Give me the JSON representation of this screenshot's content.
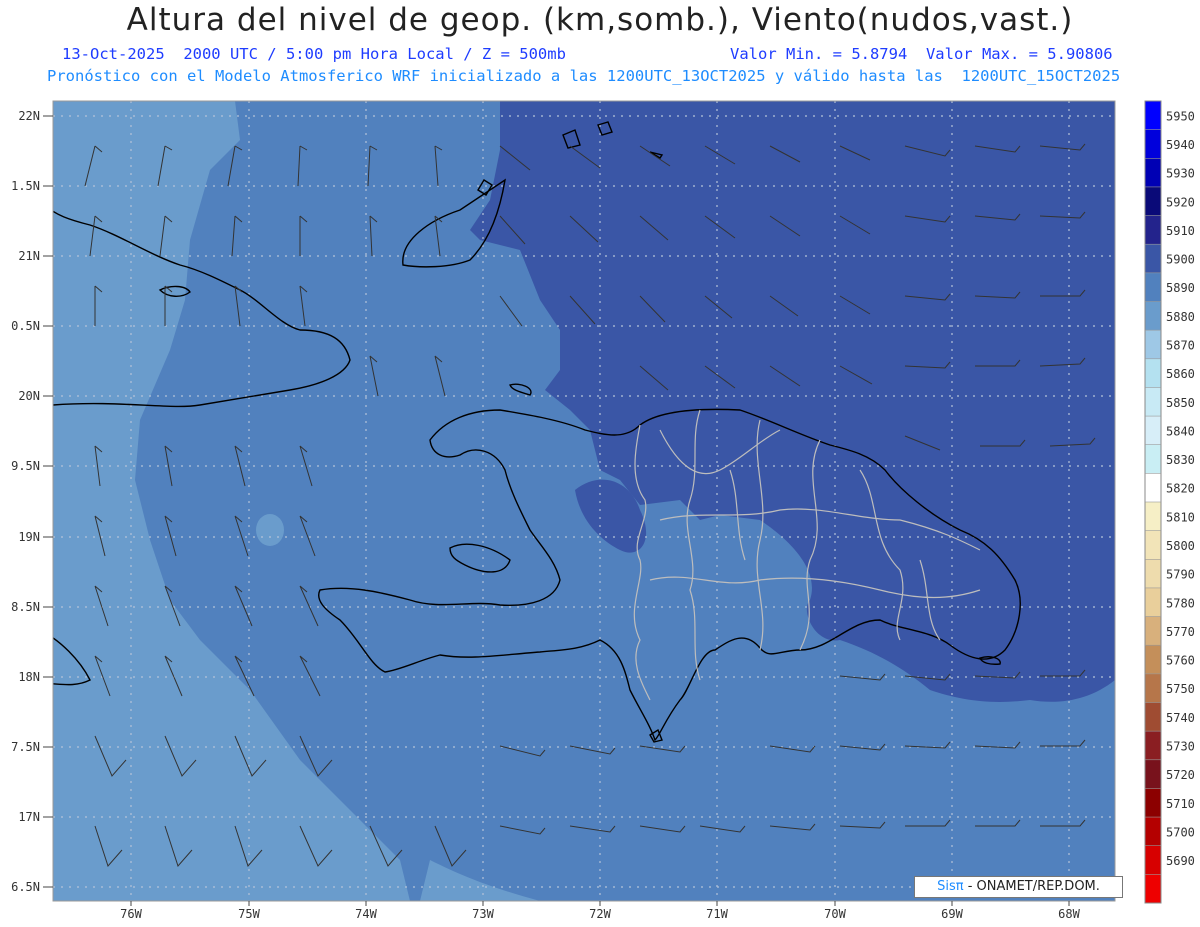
{
  "header": {
    "title": "Altura del nivel de geop. (km,somb.), Viento(nudos,vast.)",
    "datetime": "13-Oct-2025  2000 UTC / 5:00 pm Hora Local / Z = 500mb",
    "minmax": "Valor Min. = 5.8794  Valor Max. = 5.90806",
    "forecast": "Pronóstico con el Modelo Atmosferico WRF inicializado a las 1200UTC_13OCT2025 y válido hasta las  1200UTC_15OCT2025"
  },
  "map": {
    "lat_labels": [
      "22N",
      "1.5N",
      "21N",
      "0.5N",
      "20N",
      "9.5N",
      "19N",
      "8.5N",
      "18N",
      "7.5N",
      "17N",
      "6.5N"
    ],
    "lon_labels": [
      "76W",
      "75W",
      "74W",
      "73W",
      "72W",
      "71W",
      "70W",
      "69W",
      "68W"
    ],
    "colors": {
      "low": "#6a9ccc",
      "mid": "#5181be",
      "high": "#3a56a6",
      "grid": "#a9b9d0",
      "coast": "#000000",
      "border": "#b9b9b9"
    }
  },
  "colorbar": {
    "levels": [
      "5950",
      "5940",
      "5930",
      "5920",
      "5910",
      "5900",
      "5890",
      "5880",
      "5870",
      "5860",
      "5850",
      "5840",
      "5830",
      "5820",
      "5810",
      "5800",
      "5790",
      "5780",
      "5770",
      "5760",
      "5750",
      "5740",
      "5730",
      "5720",
      "5710",
      "5700",
      "5690"
    ],
    "colors": [
      "#0000ff",
      "#0000dc",
      "#0000b4",
      "#0a0a78",
      "#23238c",
      "#3a56a6",
      "#5181be",
      "#6a9ccc",
      "#9ec8e6",
      "#b4e1f0",
      "#c8eaf5",
      "#d7eef8",
      "#c9eef4",
      "#ffffff",
      "#f6efc6",
      "#f2e4b8",
      "#eedcad",
      "#e9cf9b",
      "#d8b07c",
      "#c48f5a",
      "#b6764a",
      "#9f4c32",
      "#8a1e22",
      "#78121c",
      "#8c0000",
      "#b40000",
      "#d70000",
      "#ee0000"
    ]
  },
  "credit": {
    "logo": "Sisπ",
    "text": "- ONAMET/REP.DOM."
  }
}
